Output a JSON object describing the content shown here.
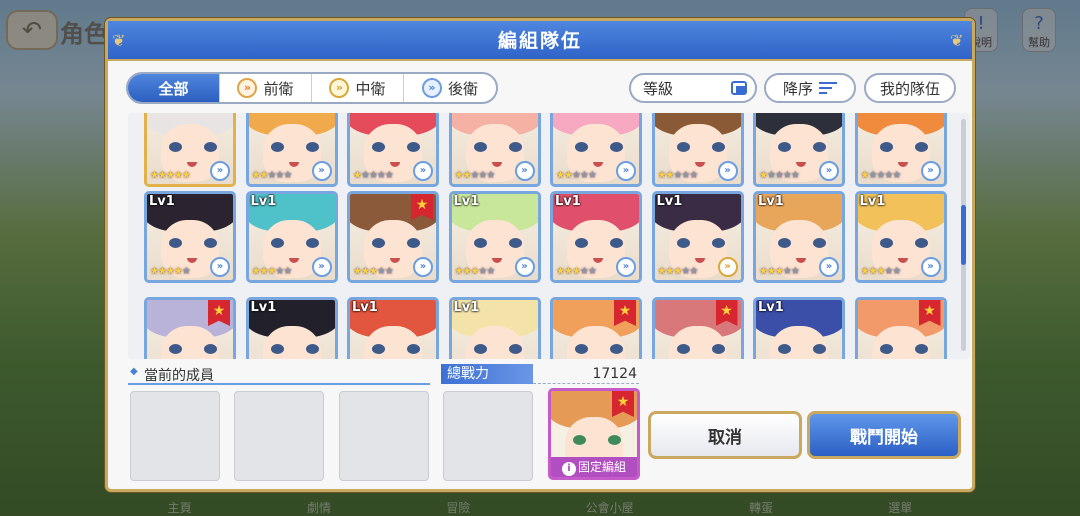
{
  "background": {
    "title": "角色",
    "icons": [
      {
        "name": "help-icon",
        "label": "說明",
        "glyph": "!"
      },
      {
        "name": "hint-icon",
        "label": "幫助",
        "glyph": "?"
      }
    ],
    "bottom_tabs": [
      "主頁",
      "劇情",
      "冒險",
      "公會小屋",
      "轉蛋",
      "選單"
    ]
  },
  "dialog": {
    "title": "編組隊伍"
  },
  "role_tabs": [
    {
      "label": "全部",
      "active": true
    },
    {
      "label": "前衛",
      "icon": "front-role-icon"
    },
    {
      "label": "中衛",
      "icon": "middle-role-icon"
    },
    {
      "label": "後衛",
      "icon": "back-role-icon"
    }
  ],
  "sort": {
    "level_label": "等級",
    "order_label": "降序",
    "myteam_label": "我的隊伍"
  },
  "units": [
    {
      "hair": "#e9e4e4",
      "stars": 5,
      "role": "back",
      "lv": "",
      "gold": true
    },
    {
      "hair": "#f0a94b",
      "stars": 2,
      "role": "back",
      "lv": ""
    },
    {
      "hair": "#e54b5a",
      "stars": 1,
      "role": "back",
      "lv": ""
    },
    {
      "hair": "#f5b1a4",
      "stars": 2,
      "role": "back",
      "lv": ""
    },
    {
      "hair": "#f6a9c0",
      "stars": 2,
      "role": "back",
      "lv": ""
    },
    {
      "hair": "#8a5a36",
      "stars": 2,
      "role": "back",
      "lv": ""
    },
    {
      "hair": "#2d2f3a",
      "stars": 1,
      "role": "back",
      "lv": ""
    },
    {
      "hair": "#f08a3c",
      "stars": 1,
      "role": "back",
      "lv": ""
    },
    {
      "hair": "#2b2430",
      "stars": 4,
      "role": "back",
      "lv": "Lv1"
    },
    {
      "hair": "#4fc1c9",
      "stars": 3,
      "role": "back",
      "lv": "Lv1"
    },
    {
      "hair": "#8a5a3a",
      "stars": 3,
      "role": "back",
      "lv": "",
      "ribbon": true
    },
    {
      "hair": "#c9e79a",
      "stars": 3,
      "role": "back",
      "lv": "Lv1"
    },
    {
      "hair": "#e0506c",
      "stars": 3,
      "role": "back",
      "lv": "Lv1"
    },
    {
      "hair": "#3b2c45",
      "stars": 3,
      "role": "mid",
      "lv": "Lv1"
    },
    {
      "hair": "#e8a65a",
      "stars": 3,
      "role": "back",
      "lv": "Lv1"
    },
    {
      "hair": "#f2c15a",
      "stars": 3,
      "role": "back",
      "lv": "Lv1"
    },
    {
      "hair": "#b9b3d9",
      "stars": 0,
      "role": "back",
      "lv": "",
      "ribbon": true
    },
    {
      "hair": "#22202a",
      "stars": 0,
      "role": "back",
      "lv": "Lv1"
    },
    {
      "hair": "#e2553e",
      "stars": 0,
      "role": "back",
      "lv": "Lv1"
    },
    {
      "hair": "#f3e3a8",
      "stars": 0,
      "role": "back",
      "lv": "Lv1"
    },
    {
      "hair": "#f0a05a",
      "stars": 0,
      "role": "back",
      "lv": "",
      "ribbon": true
    },
    {
      "hair": "#d9787a",
      "stars": 0,
      "role": "back",
      "lv": "",
      "ribbon": true
    },
    {
      "hair": "#3c4fa8",
      "stars": 0,
      "role": "back",
      "lv": "Lv1"
    },
    {
      "hair": "#f39a6a",
      "stars": 0,
      "role": "back",
      "lv": "",
      "ribbon": true
    }
  ],
  "members": {
    "label": "當前的成員",
    "power_label": "總戰力",
    "power_value": "17124",
    "fixed_label": "固定編組"
  },
  "buttons": {
    "cancel": "取消",
    "start": "戰鬥開始"
  },
  "colors": {
    "accent_blue": "#2f63c8",
    "gold_frame": "#c9a860",
    "star_on": "#ffd23a"
  }
}
